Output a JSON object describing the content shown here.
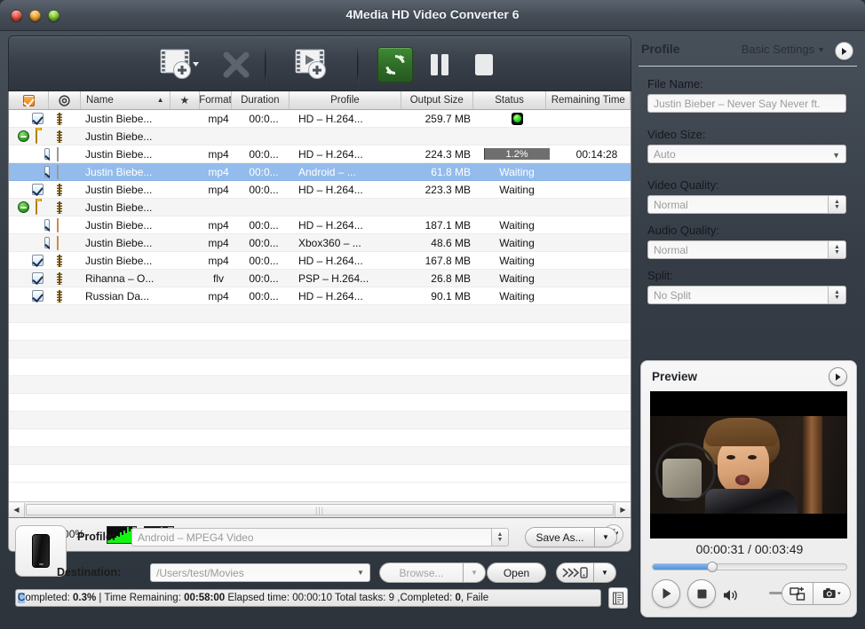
{
  "window": {
    "title": "4Media HD Video Converter 6",
    "traffic_lights": [
      "close",
      "minimize",
      "zoom"
    ]
  },
  "toolbar": {
    "buttons": [
      {
        "name": "add-file-button",
        "icon": "add-film-icon",
        "label": "Add File"
      },
      {
        "name": "remove-button",
        "icon": "close-x-icon",
        "label": "Remove"
      },
      {
        "name": "add-profile-button",
        "icon": "add-profile-film-icon",
        "label": "Add Profile"
      },
      {
        "name": "convert-button",
        "icon": "convert-refresh-icon",
        "label": "Convert"
      },
      {
        "name": "pause-button",
        "icon": "pause-icon",
        "label": "Pause"
      },
      {
        "name": "stop-button",
        "icon": "stop-icon",
        "label": "Stop"
      }
    ]
  },
  "filelist": {
    "columns": [
      {
        "key": "check",
        "label": "",
        "icon": "checkbox-header-icon"
      },
      {
        "key": "target",
        "label": "",
        "icon": "target-icon"
      },
      {
        "key": "name",
        "label": "Name",
        "sort": "ascending"
      },
      {
        "key": "star",
        "label": "",
        "icon": "star-icon"
      },
      {
        "key": "format",
        "label": "Format"
      },
      {
        "key": "duration",
        "label": "Duration"
      },
      {
        "key": "profile",
        "label": "Profile"
      },
      {
        "key": "outsize",
        "label": "Output Size"
      },
      {
        "key": "status",
        "label": "Status"
      },
      {
        "key": "remaining",
        "label": "Remaining Time"
      }
    ],
    "rows": [
      {
        "kind": "file",
        "indent": 0,
        "checked": true,
        "icon": "film-icon",
        "name": "Justin Biebe...",
        "format": "mp4",
        "duration": "00:0...",
        "profile": "HD – H.264...",
        "outsize": "259.7 MB",
        "status": "done",
        "status_text": "",
        "remaining": ""
      },
      {
        "kind": "group",
        "indent": 0,
        "expanded": true,
        "icon": "folder-icon",
        "secondary_icon": "film-icon",
        "name": "Justin Biebe...",
        "format": "",
        "duration": "",
        "profile": "",
        "outsize": "",
        "status": "",
        "status_text": "",
        "remaining": ""
      },
      {
        "kind": "child",
        "indent": 1,
        "checked": true,
        "icon": "doc-icon",
        "name": "Justin Biebe...",
        "format": "mp4",
        "duration": "00:0...",
        "profile": "HD – H.264...",
        "outsize": "224.3 MB",
        "status": "progress",
        "status_text": "1.2%",
        "progress": 1.2,
        "remaining": "00:14:28"
      },
      {
        "kind": "child",
        "indent": 1,
        "checked": true,
        "icon": "doc-icon",
        "selected": true,
        "name": "Justin Biebe...",
        "format": "mp4",
        "duration": "00:0...",
        "profile": "Android – ...",
        "outsize": "61.8 MB",
        "status": "text",
        "status_text": "Waiting",
        "remaining": ""
      },
      {
        "kind": "file",
        "indent": 0,
        "checked": true,
        "icon": "film-icon",
        "name": "Justin Biebe...",
        "format": "mp4",
        "duration": "00:0...",
        "profile": "HD – H.264...",
        "outsize": "223.3 MB",
        "status": "text",
        "status_text": "Waiting",
        "remaining": ""
      },
      {
        "kind": "group",
        "indent": 0,
        "expanded": true,
        "icon": "folder-icon",
        "secondary_icon": "film-icon",
        "name": "Justin Biebe...",
        "format": "",
        "duration": "",
        "profile": "",
        "outsize": "",
        "status": "",
        "status_text": "",
        "remaining": ""
      },
      {
        "kind": "child",
        "indent": 1,
        "checked": true,
        "icon": "doc-orange-icon",
        "name": "Justin Biebe...",
        "format": "mp4",
        "duration": "00:0...",
        "profile": "HD – H.264...",
        "outsize": "187.1 MB",
        "status": "text",
        "status_text": "Waiting",
        "remaining": ""
      },
      {
        "kind": "child",
        "indent": 1,
        "checked": true,
        "icon": "doc-orange-icon",
        "name": "Justin Biebe...",
        "format": "mp4",
        "duration": "00:0...",
        "profile": "Xbox360 – ...",
        "outsize": "48.6 MB",
        "status": "text",
        "status_text": "Waiting",
        "remaining": ""
      },
      {
        "kind": "file",
        "indent": 0,
        "checked": true,
        "icon": "film-icon",
        "name": "Justin Biebe...",
        "format": "mp4",
        "duration": "00:0...",
        "profile": "HD – H.264...",
        "outsize": "167.8 MB",
        "status": "text",
        "status_text": "Waiting",
        "remaining": ""
      },
      {
        "kind": "file",
        "indent": 0,
        "checked": true,
        "icon": "film-icon",
        "name": "Rihanna – O...",
        "format": "flv",
        "duration": "00:0...",
        "profile": "PSP – H.264...",
        "outsize": "26.8 MB",
        "status": "text",
        "status_text": "Waiting",
        "remaining": ""
      },
      {
        "kind": "file",
        "indent": 0,
        "checked": true,
        "icon": "film-icon",
        "name": "Russian Da...",
        "format": "mp4",
        "duration": "00:0...",
        "profile": "HD – H.264...",
        "outsize": "90.1 MB",
        "status": "text",
        "status_text": "Waiting",
        "remaining": ""
      }
    ]
  },
  "cpu": {
    "label": "CPU:100.00%",
    "meters": [
      [
        3,
        4,
        5,
        4,
        6,
        8,
        7,
        12,
        9,
        14,
        11,
        18,
        13,
        16,
        20,
        20
      ],
      [
        4,
        6,
        5,
        8,
        7,
        10,
        9,
        15,
        12,
        19,
        14,
        17,
        16,
        20,
        18,
        20
      ]
    ],
    "settings_icon": "wrench-icon"
  },
  "bottom": {
    "device_icon": "phone-icon",
    "profile_label": "Profile:",
    "profile_value": "Android – MPEG4 Video",
    "save_as_label": "Save As...",
    "destination_label": "Destination:",
    "destination_value": "/Users/test/Movies",
    "browse_label": "Browse...",
    "open_label": "Open",
    "burn_icon": "send-to-device-icon",
    "status": {
      "full_text": "Completed: 0.3% | Time Remaining: 00:58:00 Elapsed time: 00:00:10 Total tasks: 9 ,Completed: 0, Faile",
      "completed_label": "Completed:",
      "completed_value": "0.3%",
      "time_remaining_label": "Time Remaining:",
      "time_remaining_value": "00:58:00",
      "elapsed_label": "Elapsed time:",
      "elapsed_value": "00:00:10",
      "total_tasks_label": "Total tasks:",
      "total_tasks_value": "9",
      "completed_count_label": ",Completed:",
      "completed_count_value": "0",
      "failed_label": ", Faile"
    },
    "log_icon": "log-icon"
  },
  "profile_panel": {
    "title": "Profile",
    "settings_mode": "Basic Settings",
    "expand_icon": "expand-arrow-icon",
    "fields": [
      {
        "name": "file-name",
        "label": "File Name:",
        "value": "Justin Bieber – Never Say Never ft.",
        "control": "text"
      },
      {
        "name": "video-size",
        "label": "Video Size:",
        "value": "Auto",
        "control": "combo"
      },
      {
        "name": "video-quality",
        "label": "Video Quality:",
        "value": "Normal",
        "control": "stepper"
      },
      {
        "name": "audio-quality",
        "label": "Audio Quality:",
        "value": "Normal",
        "control": "stepper"
      },
      {
        "name": "split",
        "label": "Split:",
        "value": "No Split",
        "control": "stepper"
      }
    ]
  },
  "preview": {
    "title": "Preview",
    "expand_icon": "expand-arrow-icon",
    "current_time": "00:00:31",
    "total_time": "00:03:49",
    "timecode": "00:00:31 / 00:03:49",
    "seek_percent": 30,
    "volume_percent": 70,
    "controls": [
      {
        "name": "play-button",
        "icon": "play-icon"
      },
      {
        "name": "stop-button",
        "icon": "stop-icon"
      },
      {
        "name": "volume-icon",
        "icon": "speaker-icon"
      },
      {
        "name": "crop-button",
        "icon": "crop-icon"
      },
      {
        "name": "snapshot-button",
        "icon": "camera-icon"
      }
    ]
  }
}
